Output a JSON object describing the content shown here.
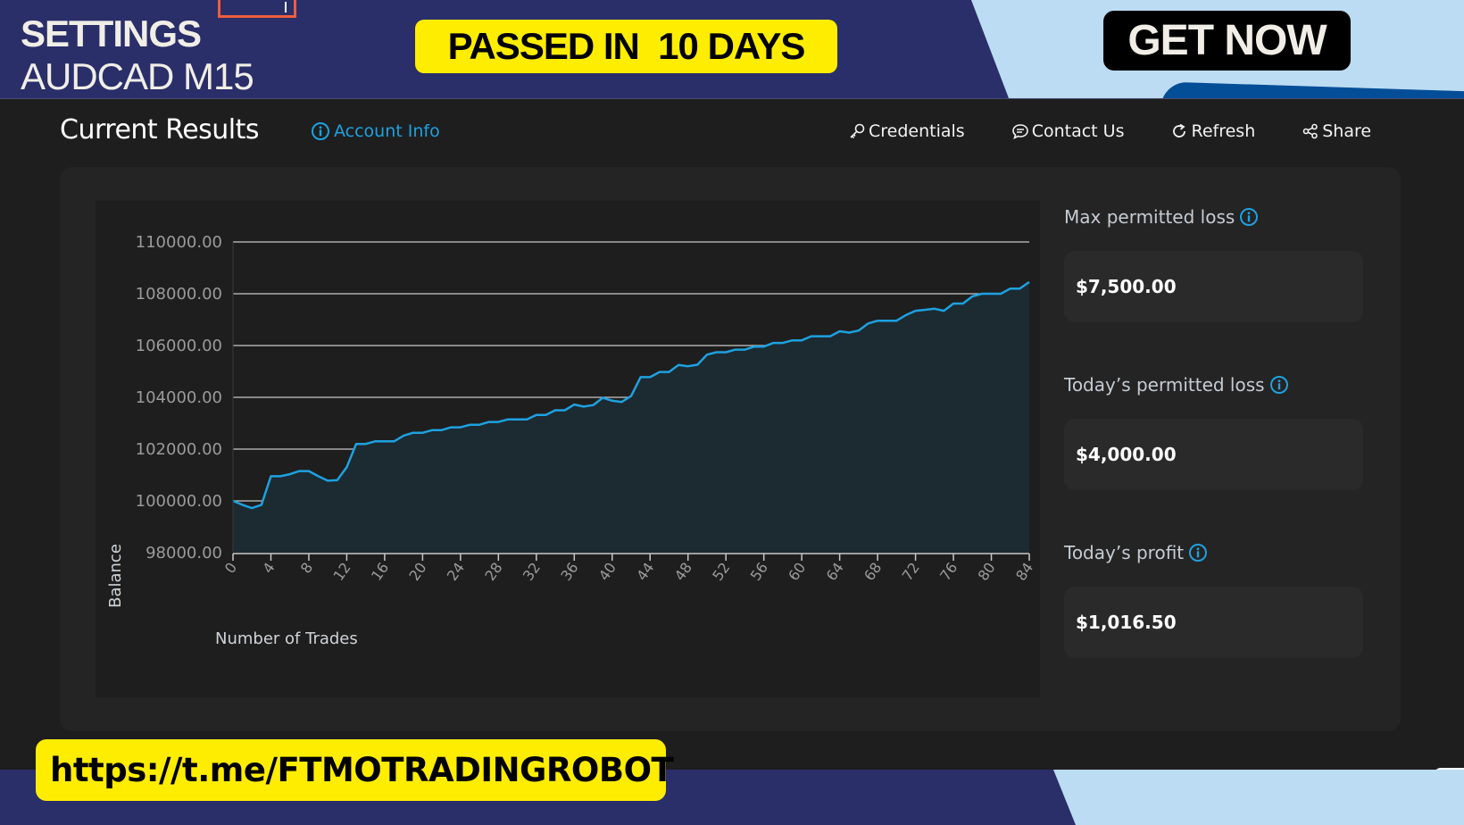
{
  "banner": {
    "title": "SETTINGS",
    "subtitle": "AUDCAD M15",
    "badge": "PASSED IN  10 DAYS",
    "cta": "GET NOW",
    "link": "https://t.me/FTMOTRADINGROBOT"
  },
  "toolbar": {
    "title": "Current Results",
    "account_info": "Account Info",
    "actions": [
      {
        "label": "Credentials",
        "icon": "key-icon"
      },
      {
        "label": "Contact Us",
        "icon": "chat-icon"
      },
      {
        "label": "Refresh",
        "icon": "refresh-icon"
      },
      {
        "label": "Share",
        "icon": "share-icon"
      }
    ]
  },
  "stats": [
    {
      "label": "Max permitted loss",
      "value": "$7,500.00"
    },
    {
      "label": "Today’s permitted loss",
      "value": "$4,000.00"
    },
    {
      "label": "Today’s profit",
      "value": "$1,016.50"
    }
  ],
  "colors": {
    "accent": "#1ea1e0",
    "line": "#1ea1e0",
    "fill": "#1c2a32",
    "badge": "#ffed00",
    "banner": "#2a2e69"
  },
  "chart_data": {
    "type": "area",
    "title": "",
    "xlabel": "Number of Trades",
    "ylabel": "Balance",
    "xlim": [
      0,
      84
    ],
    "ylim": [
      98000,
      110000
    ],
    "grid": true,
    "yticks": [
      "98000.00",
      "100000.00",
      "102000.00",
      "104000.00",
      "106000.00",
      "108000.00",
      "110000.00"
    ],
    "ytick_values": [
      98000,
      100000,
      102000,
      104000,
      106000,
      108000,
      110000
    ],
    "xticks": [
      0,
      4,
      8,
      12,
      16,
      20,
      24,
      28,
      32,
      36,
      40,
      44,
      48,
      52,
      56,
      60,
      64,
      68,
      72,
      76,
      80,
      84
    ],
    "series": [
      {
        "name": "Balance",
        "x": [
          0,
          1,
          2,
          3,
          4,
          5,
          6,
          7,
          8,
          9,
          10,
          11,
          12,
          13,
          14,
          15,
          16,
          17,
          18,
          19,
          20,
          21,
          22,
          23,
          24,
          25,
          26,
          27,
          28,
          29,
          30,
          31,
          32,
          33,
          34,
          35,
          36,
          37,
          38,
          39,
          40,
          41,
          42,
          43,
          44,
          45,
          46,
          47,
          48,
          49,
          50,
          51,
          52,
          53,
          54,
          55,
          56,
          57,
          58,
          59,
          60,
          61,
          62,
          63,
          64,
          65,
          66,
          67,
          68,
          69,
          70,
          71,
          72,
          73,
          74,
          75,
          76,
          77,
          78,
          79,
          80,
          81,
          82,
          83,
          84
        ],
        "values": [
          100000,
          99850,
          99720,
          99850,
          100950,
          100950,
          101030,
          101150,
          101150,
          100950,
          100780,
          100800,
          101300,
          102200,
          102200,
          102300,
          102300,
          102300,
          102520,
          102630,
          102630,
          102730,
          102730,
          102840,
          102840,
          102940,
          102940,
          103050,
          103050,
          103150,
          103150,
          103150,
          103320,
          103320,
          103500,
          103500,
          103720,
          103640,
          103700,
          103980,
          103870,
          103820,
          104050,
          104780,
          104780,
          104980,
          104980,
          105250,
          105200,
          105260,
          105650,
          105740,
          105740,
          105840,
          105840,
          105960,
          105960,
          106100,
          106100,
          106200,
          106200,
          106360,
          106360,
          106360,
          106550,
          106500,
          106580,
          106850,
          106960,
          106960,
          106960,
          107180,
          107340,
          107380,
          107420,
          107340,
          107620,
          107620,
          107900,
          108000,
          108000,
          108000,
          108200,
          108200,
          108450
        ]
      }
    ]
  }
}
